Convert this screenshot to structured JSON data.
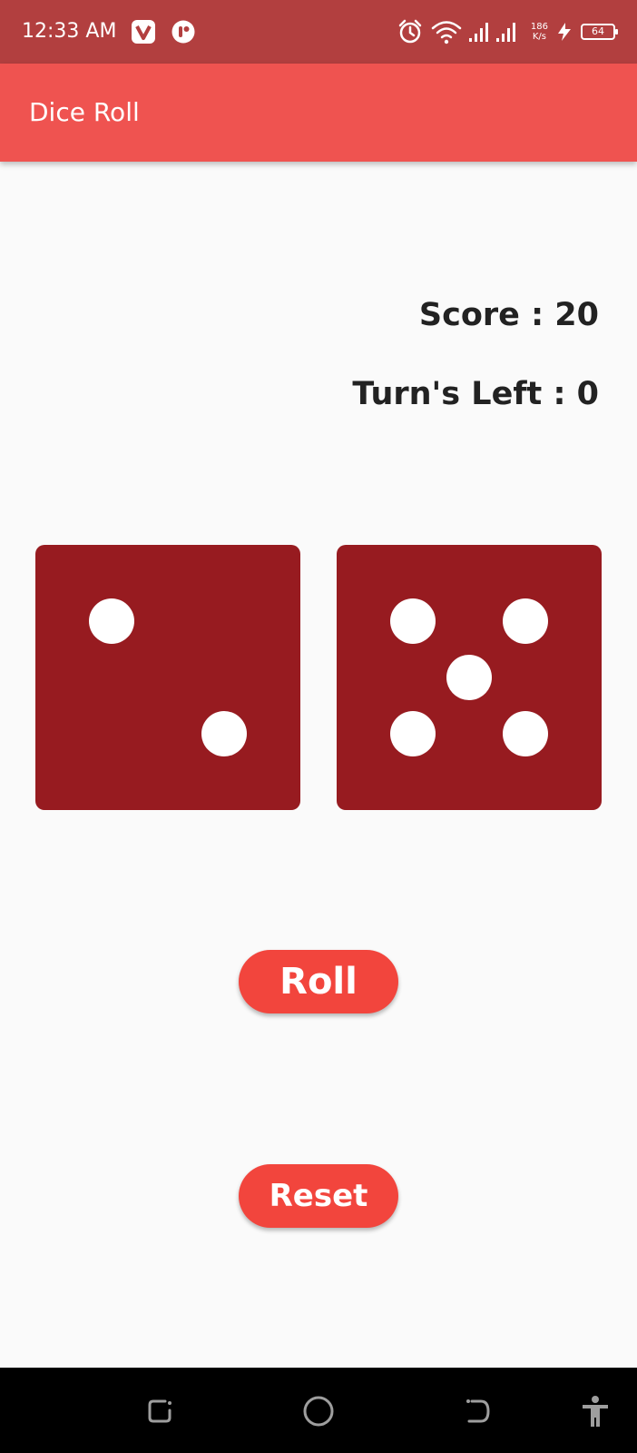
{
  "status_bar": {
    "time": "12:33 AM",
    "net_speed_value": "186",
    "net_speed_unit": "K/s",
    "battery": "64",
    "app_icons": [
      "vpn-app-icon",
      "messenger-app-icon"
    ],
    "indicator_icons": [
      "alarm-icon",
      "wifi-icon",
      "signal-icon",
      "charging-icon",
      "battery-icon"
    ]
  },
  "app_bar": {
    "title": "Dice Roll"
  },
  "game": {
    "score_text": "Score : 20",
    "turns_text": "Turn's Left : 0",
    "dice": [
      {
        "value": 2
      },
      {
        "value": 5
      }
    ],
    "die_color": "#971b20",
    "pip_color": "#ffffff"
  },
  "buttons": {
    "roll_label": "Roll",
    "reset_label": "Reset",
    "color": "#f2453d"
  },
  "nav_bar": {
    "icons": [
      "recent-apps-icon",
      "home-icon",
      "back-icon",
      "accessibility-icon"
    ]
  },
  "colors": {
    "status_bar": "#b23f3f",
    "app_bar": "#ef5350",
    "background": "#fafafa"
  }
}
